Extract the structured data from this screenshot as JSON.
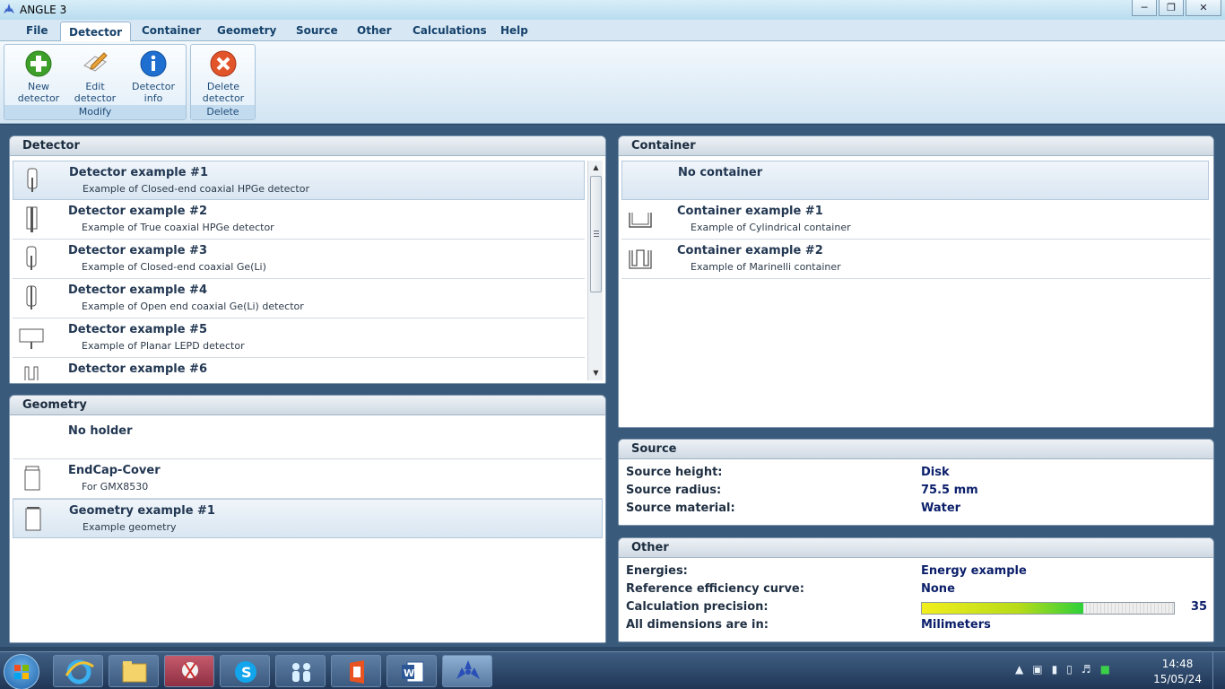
{
  "window": {
    "title": "ANGLE 3"
  },
  "menu": {
    "items": [
      "File",
      "Detector",
      "Container",
      "Geometry",
      "Source",
      "Other",
      "Calculations",
      "Help"
    ],
    "active": "Detector"
  },
  "ribbon": {
    "groups": [
      {
        "label": "Modify",
        "buttons": [
          {
            "label1": "New",
            "label2": "detector",
            "icon": "plus-icon"
          },
          {
            "label1": "Edit",
            "label2": "detector",
            "icon": "edit-icon"
          },
          {
            "label1": "Detector",
            "label2": "info",
            "icon": "info-icon"
          }
        ]
      },
      {
        "label": "Delete",
        "buttons": [
          {
            "label1": "Delete",
            "label2": "detector",
            "icon": "delete-icon"
          }
        ]
      }
    ]
  },
  "detector_panel": {
    "title": "Detector",
    "items": [
      {
        "title": "Detector example #1",
        "subtitle": "Example of Closed-end coaxial HPGe detector",
        "icon": "closed-end-coaxial-icon",
        "selected": true
      },
      {
        "title": "Detector example #2",
        "subtitle": "Example of True coaxial HPGe detector",
        "icon": "true-coaxial-icon",
        "selected": false
      },
      {
        "title": "Detector example #3",
        "subtitle": "Example of Closed-end coaxial Ge(Li)",
        "icon": "closed-end-coaxial-icon",
        "selected": false
      },
      {
        "title": "Detector example #4",
        "subtitle": "Example of Open end coaxial Ge(Li) detector",
        "icon": "open-end-coaxial-icon",
        "selected": false
      },
      {
        "title": "Detector example #5",
        "subtitle": "Example of Planar LEPD detector",
        "icon": "planar-icon",
        "selected": false
      },
      {
        "title": "Detector example #6",
        "subtitle": "",
        "icon": "well-icon",
        "selected": false
      }
    ]
  },
  "container_panel": {
    "title": "Container",
    "items": [
      {
        "title": "No container",
        "subtitle": "",
        "icon": "",
        "selected": true
      },
      {
        "title": "Container example #1",
        "subtitle": "Example of Cylindrical container",
        "icon": "cylindrical-container-icon",
        "selected": false
      },
      {
        "title": "Container example #2",
        "subtitle": "Example of Marinelli container",
        "icon": "marinelli-container-icon",
        "selected": false
      }
    ]
  },
  "geometry_panel": {
    "title": "Geometry",
    "items": [
      {
        "title": "No holder",
        "subtitle": "",
        "icon": "",
        "selected": false
      },
      {
        "title": "EndCap-Cover",
        "subtitle": "For GMX8530",
        "icon": "endcap-cover-icon",
        "selected": false
      },
      {
        "title": "Geometry example #1",
        "subtitle": "Example geometry",
        "icon": "holder-icon",
        "selected": true
      }
    ]
  },
  "source_panel": {
    "title": "Source",
    "props": [
      {
        "label": "Source height:",
        "value": "Disk"
      },
      {
        "label": "Source radius:",
        "value": "75.5 mm"
      },
      {
        "label": "Source material:",
        "value": "Water"
      }
    ]
  },
  "other_panel": {
    "title": "Other",
    "energies_label": "Energies:",
    "energies_value": "Energy example",
    "ref_label": "Reference efficiency curve:",
    "ref_value": "None",
    "precision_label": "Calculation precision:",
    "precision_value": "35",
    "precision_fraction": 0.64,
    "dims_label": "All dimensions are in:",
    "dims_value": "Milimeters"
  },
  "taskbar": {
    "apps": [
      "internet-explorer-icon",
      "file-explorer-icon",
      "snipping-tool-icon",
      "skype-icon",
      "people-icon",
      "office-icon",
      "word-icon",
      "angle-icon"
    ],
    "active_app": "angle-icon",
    "time": "14:48",
    "date": "15/05/24"
  },
  "colors": {
    "accent": "#1e4b78",
    "value_text": "#0b1f6a",
    "workspace": "#3a5a7c"
  }
}
